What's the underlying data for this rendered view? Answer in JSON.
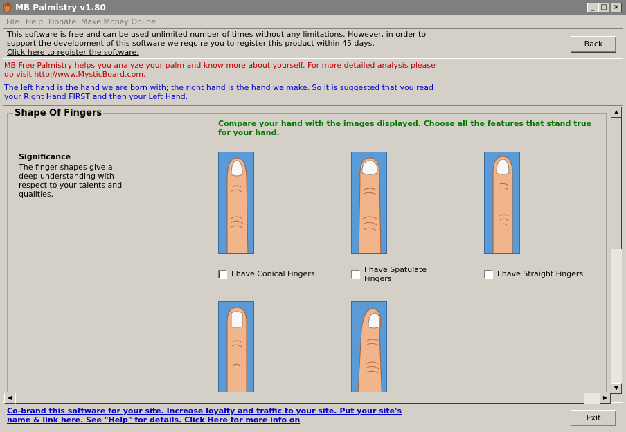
{
  "window": {
    "title": "MB Palmistry v1.80",
    "minimize": "_",
    "maximize": "□",
    "close": "×"
  },
  "menu": [
    "File",
    "Help",
    "Donate",
    "Make Money Online"
  ],
  "registration": {
    "text": "This software is free and can be used unlimited number of times without any limitations. However, in order to support the development of this software we require you to register this product within 45 days.",
    "link": "Click here to register the software.",
    "back_button": "Back"
  },
  "intro": {
    "red": "MB Free Palmistry helps you analyze your palm and know more about yourself. For more detailed analysis please do visit http://www.MysticBoard.com.",
    "blue": "The left hand is the hand we are born with; the right hand is the hand we make. So it is suggested that you read your Right Hand FIRST and then your Left Hand."
  },
  "section": {
    "title": "Shape Of Fingers",
    "instruction": "Compare your hand with the images displayed. Choose all the features that stand true for your hand.",
    "significance_title": "Significance",
    "significance_text": "The finger shapes give a deep understanding with respect to your talents and qualities.",
    "options": [
      {
        "label": "I have Conical Fingers",
        "checked": false
      },
      {
        "label": "I have Spatulate Fingers",
        "checked": false
      },
      {
        "label": "I have Straight Fingers",
        "checked": false
      },
      {
        "label": "",
        "checked": false
      },
      {
        "label": "",
        "checked": false
      }
    ]
  },
  "footer": {
    "link": "Co-brand this software for your site.  Increase loyalty and traffic to your site. Put your site's name &  link here. See \"Help\" for details.    Click Here for more info on",
    "exit_button": "Exit"
  },
  "colors": {
    "finger_bg": "#5a9ad6",
    "skin": "#f2b48a",
    "instruction": "#007800",
    "intro_red": "#c00000",
    "intro_blue": "#0000c8"
  }
}
